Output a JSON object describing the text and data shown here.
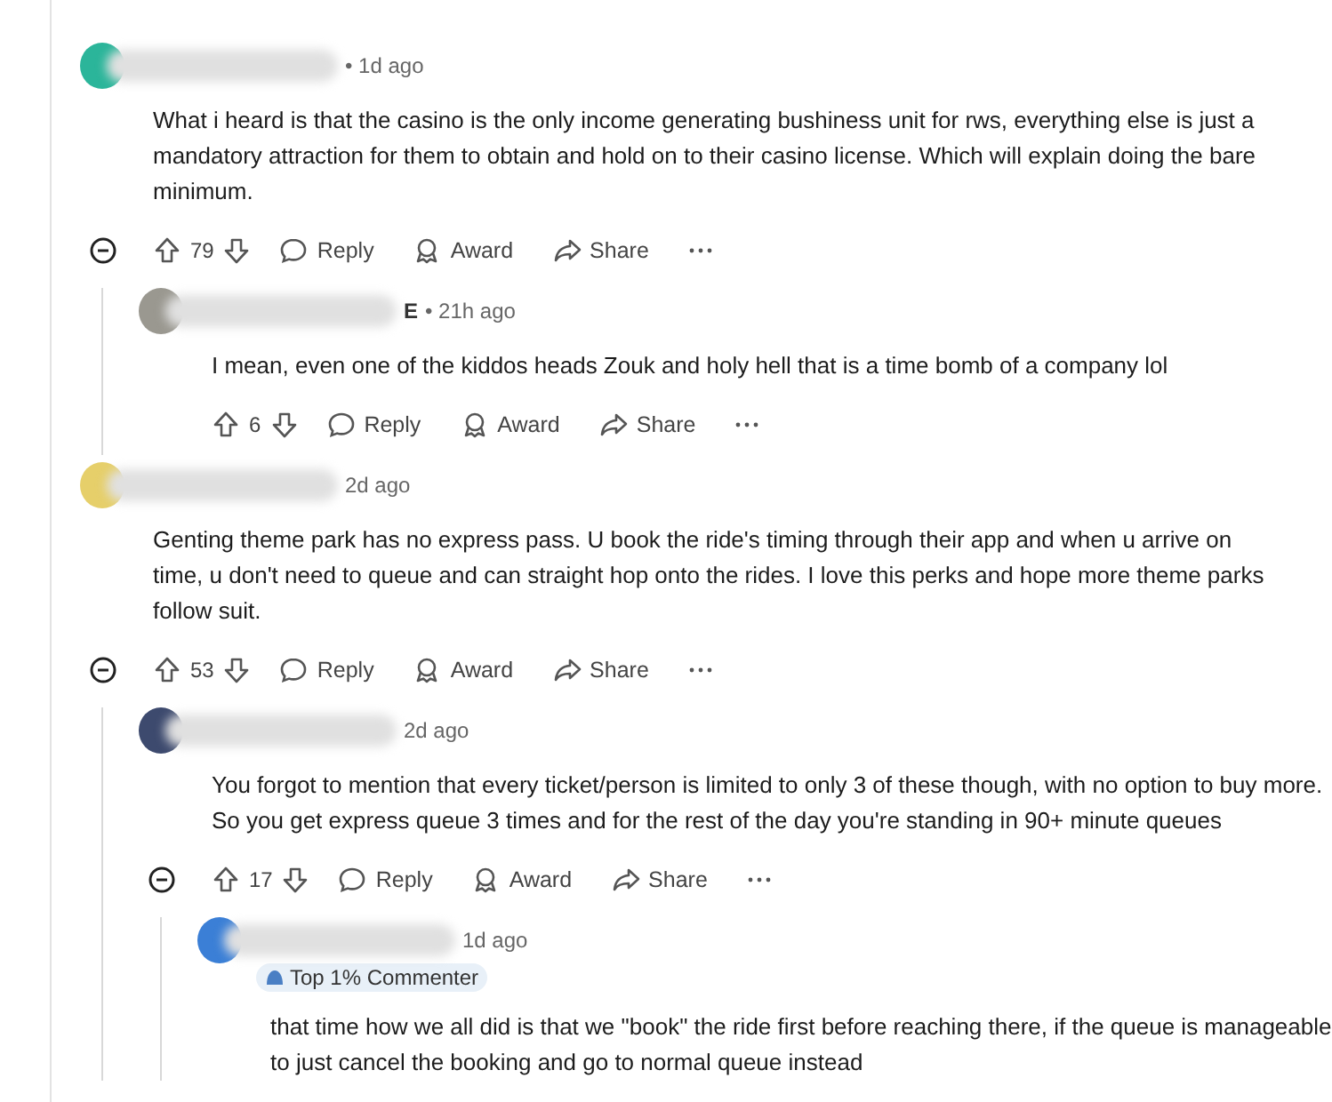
{
  "comments": [
    {
      "color": "#2bb59a",
      "time": "• 1d ago",
      "body": "What i heard is that the casino is the only income generating bushiness unit for rws, everything else is just a mandatory attraction for them to obtain and hold on to their casino license. Which will explain doing the bare minimum.",
      "votes": "79",
      "actions": [
        "Reply",
        "Award",
        "Share"
      ],
      "children": [
        {
          "color": "#9a9890",
          "author": "E",
          "time": "• 21h ago",
          "body": "I mean, even one of the kiddos heads Zouk and holy hell that is a time bomb of a company lol",
          "votes": "6",
          "actions": [
            "Reply",
            "Award",
            "Share"
          ]
        }
      ]
    },
    {
      "color": "#e6cf6a",
      "time": "2d ago",
      "body": "Genting theme park has no express pass. U book the ride's timing through their app and when u arrive on time, u don't need to queue and can straight hop onto the rides. I love this perks and hope more theme parks follow suit.",
      "votes": "53",
      "actions": [
        "Reply",
        "Award",
        "Share"
      ],
      "children": [
        {
          "color": "#3d4a6e",
          "time": "2d ago",
          "body": "You forgot to mention that every ticket/person is limited to only 3 of these though, with no option to buy more. So you get express queue 3 times and for the rest of the day you're standing in 90+ minute queues",
          "votes": "17",
          "actions": [
            "Reply",
            "Award",
            "Share"
          ],
          "children": [
            {
              "color": "#3b7fd6",
              "time": "1d ago",
              "badge": "Top 1% Commenter",
              "body": "that time how we all did is that we \"book\" the ride first before reaching there, if the queue is manageable to just cancel the booking and go to normal queue instead"
            }
          ]
        }
      ]
    }
  ]
}
